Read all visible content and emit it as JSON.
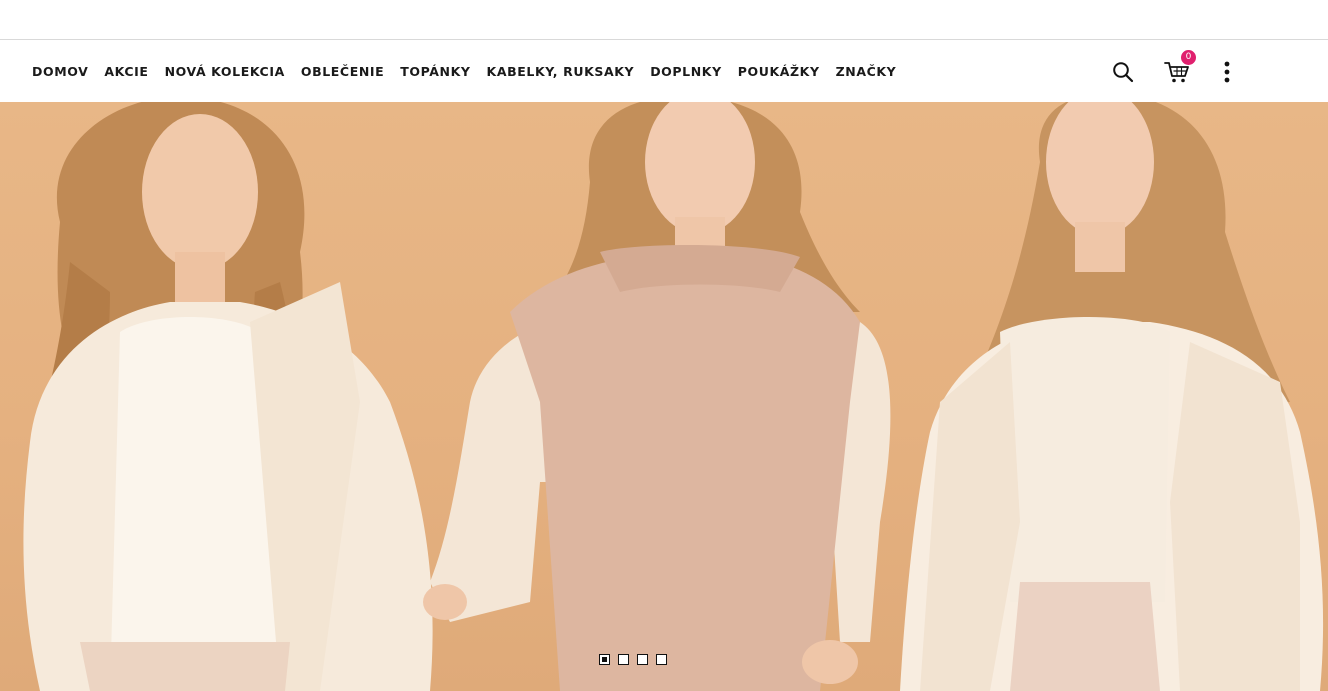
{
  "nav": {
    "items": [
      {
        "label": "DOMOV"
      },
      {
        "label": "AKCIE"
      },
      {
        "label": "NOVÁ KOLEKCIA"
      },
      {
        "label": "OBLEČENIE"
      },
      {
        "label": "TOPÁNKY"
      },
      {
        "label": "KABELKY, RUKSAKY"
      },
      {
        "label": "DOPLNKY"
      },
      {
        "label": "POUKÁŽKY"
      },
      {
        "label": "ZNAČKY"
      }
    ]
  },
  "header_icons": {
    "search": "search-icon",
    "cart": "cart-icon",
    "more": "more-vertical-icon",
    "cart_count": "0",
    "badge_color": "#e0206e"
  },
  "hero": {
    "background_color": "#e6b383",
    "slides_total": 4,
    "active_slide": 1
  }
}
